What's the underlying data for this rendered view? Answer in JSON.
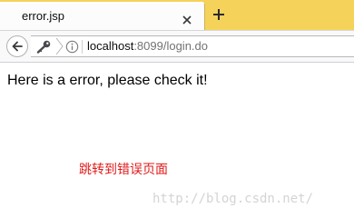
{
  "browser": {
    "tab": {
      "title": "error.jsp"
    },
    "address": {
      "host": "localhost",
      "rest": ":8099/login.do"
    }
  },
  "page": {
    "message": "Here is a error, please check it!",
    "caption": "跳转到错误页面"
  },
  "watermark": {
    "text": "http://blog.csdn.net/"
  },
  "icons": {
    "close": "close-icon",
    "new_tab": "plus-icon",
    "back": "back-arrow-icon",
    "identity": "key-icon",
    "info": "info-icon"
  },
  "colors": {
    "tabstrip": "#f5d35a",
    "caption": "#e01a1a",
    "watermark": "#d4d4d4"
  }
}
